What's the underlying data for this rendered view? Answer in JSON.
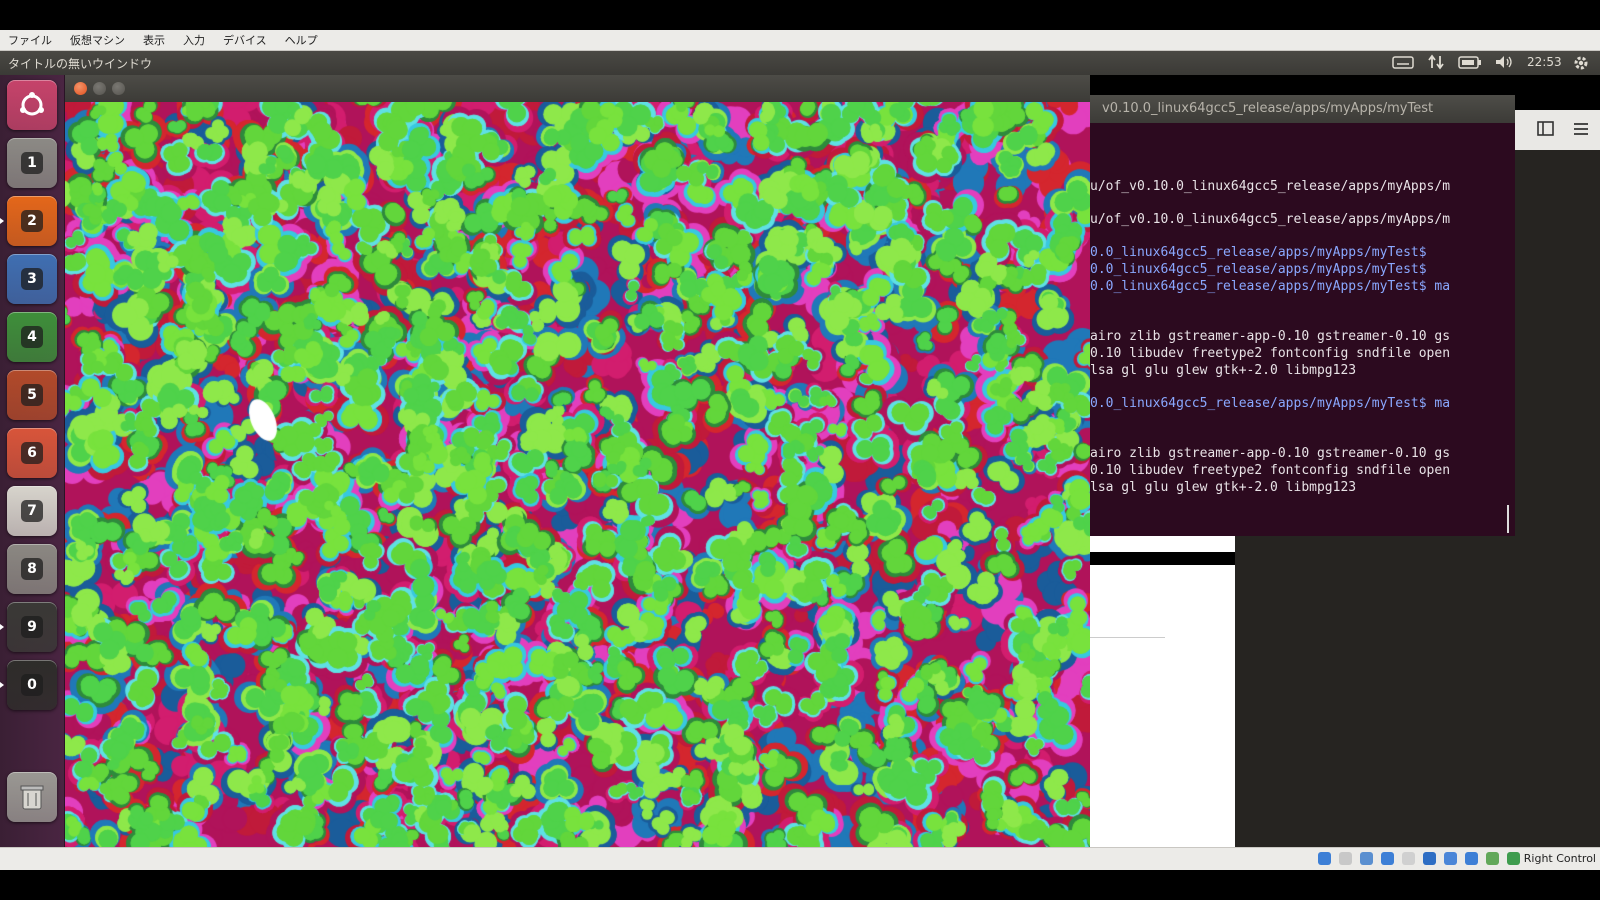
{
  "host_menu": [
    "ファイル",
    "仮想マシン",
    "表示",
    "入力",
    "デバイス",
    "ヘルプ"
  ],
  "panel": {
    "window_title": "タイトルの無いウインドウ",
    "clock": "22:53"
  },
  "launcher": {
    "items": [
      {
        "num": "",
        "color": "#c6436a",
        "icon": "ubuntu-dash-icon"
      },
      {
        "num": "1",
        "color": "#8c8a85",
        "icon": "workspace-icon"
      },
      {
        "num": "2",
        "color": "#e4671a",
        "icon": "firefox-icon"
      },
      {
        "num": "3",
        "color": "#3f6fb2",
        "icon": "writer-icon"
      },
      {
        "num": "4",
        "color": "#3e8f3a",
        "icon": "calc-icon"
      },
      {
        "num": "5",
        "color": "#b24a2a",
        "icon": "impress-icon"
      },
      {
        "num": "6",
        "color": "#d8553a",
        "icon": "software-center-icon"
      },
      {
        "num": "7",
        "color": "#d7d4cc",
        "icon": "amazon-icon"
      },
      {
        "num": "8",
        "color": "#8b8882",
        "icon": "settings-icon"
      },
      {
        "num": "9",
        "color": "#3a3936",
        "icon": "terminal-icon"
      },
      {
        "num": "0",
        "color": "#2e2d2a",
        "icon": "app-icon"
      },
      {
        "num": "",
        "color": "#9a9893",
        "icon": "trash-icon"
      }
    ]
  },
  "terminal": {
    "title": "v0.10.0_linux64gcc5_release/apps/myApps/myTest",
    "lines": [
      {
        "text": "u/of_v0.10.0_linux64gcc5_release/apps/myApps/m",
        "kind": "white"
      },
      {
        "text": "u/of_v0.10.0_linux64gcc5_release/apps/myApps/m",
        "kind": "white"
      },
      {
        "text": "0.0_linux64gcc5_release/apps/myApps/myTest$",
        "kind": "blue"
      },
      {
        "text": "0.0_linux64gcc5_release/apps/myApps/myTest$",
        "kind": "blue"
      },
      {
        "text": "0.0_linux64gcc5_release/apps/myApps/myTest$ ma",
        "kind": "blue"
      },
      {
        "text": "airo zlib gstreamer-app-0.10 gstreamer-0.10 gs",
        "kind": "white"
      },
      {
        "text": "0.10 libudev freetype2 fontconfig sndfile open",
        "kind": "white"
      },
      {
        "text": "lsa gl glu glew gtk+-2.0 libmpg123",
        "kind": "white"
      },
      {
        "text": "0.0_linux64gcc5_release/apps/myApps/myTest$ ma",
        "kind": "blue"
      },
      {
        "text": "airo zlib gstreamer-app-0.10 gstreamer-0.10 gs",
        "kind": "white"
      },
      {
        "text": "0.10 libudev freetype2 fontconfig sndfile open",
        "kind": "white"
      },
      {
        "text": "lsa gl glu glew gtk+-2.0 libmpg123",
        "kind": "white"
      }
    ]
  },
  "statusbar": {
    "host_key": "Right Control"
  },
  "colors": {
    "art_palette": [
      "#62d63b",
      "#4fd24a",
      "#78e23d",
      "#5fe0e4",
      "#38c8e0",
      "#b0135a",
      "#d21d6e",
      "#e23fbe",
      "#c01a3a",
      "#d4262e",
      "#2078b8",
      "#1a5c9a",
      "#2e8a3c",
      "#8ee84a"
    ],
    "art_background": "#b0135a"
  }
}
